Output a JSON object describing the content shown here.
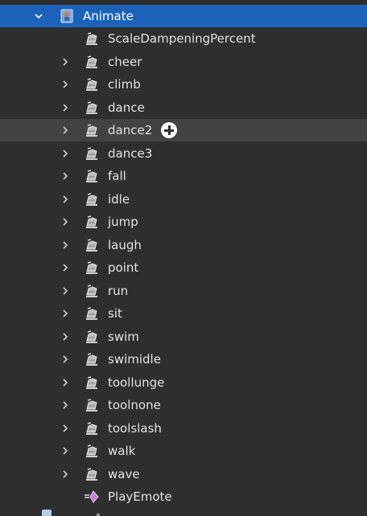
{
  "explorer": {
    "root": {
      "label": "Animate",
      "icon": "local-script-icon"
    },
    "children": [
      {
        "label": "ScaleDampeningPercent",
        "icon": "string-value-icon",
        "expandable": false
      },
      {
        "label": "cheer",
        "icon": "string-value-icon",
        "expandable": true
      },
      {
        "label": "climb",
        "icon": "string-value-icon",
        "expandable": true
      },
      {
        "label": "dance",
        "icon": "string-value-icon",
        "expandable": true
      },
      {
        "label": "dance2",
        "icon": "string-value-icon",
        "expandable": true,
        "hovered": true
      },
      {
        "label": "dance3",
        "icon": "string-value-icon",
        "expandable": true
      },
      {
        "label": "fall",
        "icon": "string-value-icon",
        "expandable": true
      },
      {
        "label": "idle",
        "icon": "string-value-icon",
        "expandable": true
      },
      {
        "label": "jump",
        "icon": "string-value-icon",
        "expandable": true
      },
      {
        "label": "laugh",
        "icon": "string-value-icon",
        "expandable": true
      },
      {
        "label": "point",
        "icon": "string-value-icon",
        "expandable": true
      },
      {
        "label": "run",
        "icon": "string-value-icon",
        "expandable": true
      },
      {
        "label": "sit",
        "icon": "string-value-icon",
        "expandable": true
      },
      {
        "label": "swim",
        "icon": "string-value-icon",
        "expandable": true
      },
      {
        "label": "swimidle",
        "icon": "string-value-icon",
        "expandable": true
      },
      {
        "label": "toollunge",
        "icon": "string-value-icon",
        "expandable": true
      },
      {
        "label": "toolnone",
        "icon": "string-value-icon",
        "expandable": true
      },
      {
        "label": "toolslash",
        "icon": "string-value-icon",
        "expandable": true
      },
      {
        "label": "walk",
        "icon": "string-value-icon",
        "expandable": true
      },
      {
        "label": "wave",
        "icon": "string-value-icon",
        "expandable": true
      },
      {
        "label": "PlayEmote",
        "icon": "bindable-function-icon",
        "expandable": false
      }
    ]
  },
  "colors": {
    "background": "#2e2e2e",
    "selection": "#1a63b8",
    "hover": "#424242",
    "text": "#e3e3e3"
  }
}
